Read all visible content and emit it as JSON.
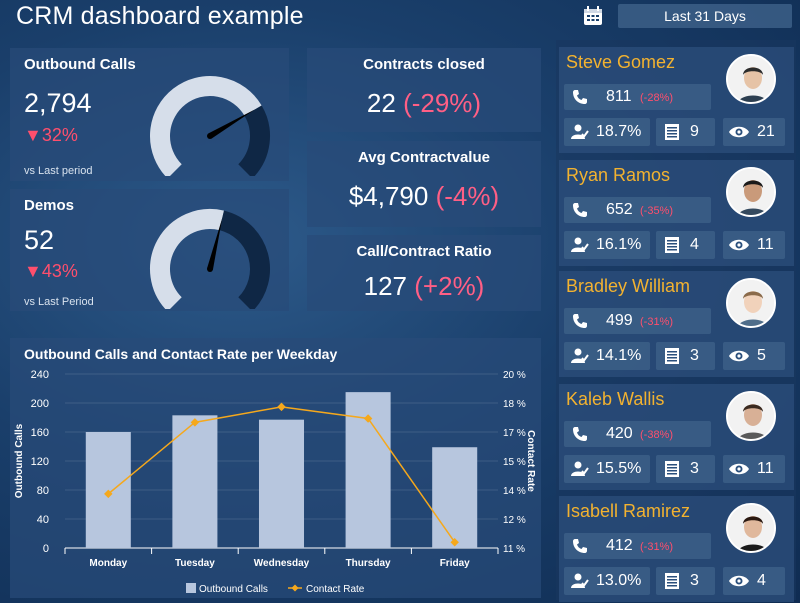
{
  "header": {
    "title": "CRM dashboard example",
    "date_range": "Last 31 Days"
  },
  "kpis": {
    "outbound_calls": {
      "title": "Outbound Calls",
      "value": "2,794",
      "change": "32%",
      "sub": "vs Last period",
      "gauge_fraction": 0.72
    },
    "demos": {
      "title": "Demos",
      "value": "52",
      "change": "43%",
      "sub": "vs Last Period",
      "gauge_fraction": 0.55
    },
    "contracts_closed": {
      "title": "Contracts closed",
      "value": "22",
      "change": "(-29%)"
    },
    "avg_contract_value": {
      "title": "Avg Contractvalue",
      "value": "$4,790",
      "change": "(-4%)"
    },
    "call_contract_ratio": {
      "title": "Call/Contract Ratio",
      "value": "127",
      "change": "(+2%)"
    }
  },
  "people": [
    {
      "name": "Steve Gomez",
      "calls": "811",
      "calls_change": "(-28%)",
      "rate": "18.7%",
      "count": "9",
      "views": "21"
    },
    {
      "name": "Ryan Ramos",
      "calls": "652",
      "calls_change": "(-35%)",
      "rate": "16.1%",
      "count": "4",
      "views": "11"
    },
    {
      "name": "Bradley William",
      "calls": "499",
      "calls_change": "(-31%)",
      "rate": "14.1%",
      "count": "3",
      "views": "5"
    },
    {
      "name": "Kaleb Wallis",
      "calls": "420",
      "calls_change": "(-38%)",
      "rate": "15.5%",
      "count": "3",
      "views": "11"
    },
    {
      "name": "Isabell Ramirez",
      "calls": "412",
      "calls_change": "(-31%)",
      "rate": "13.0%",
      "count": "3",
      "views": "4"
    }
  ],
  "chart_data": {
    "type": "bar",
    "title": "Outbound Calls and Contact Rate per Weekday",
    "categories": [
      "Monday",
      "Tuesday",
      "Wednesday",
      "Thursday",
      "Friday"
    ],
    "series": [
      {
        "name": "Outbound Calls",
        "type": "bar",
        "axis": "left",
        "values": [
          160,
          183,
          177,
          215,
          139
        ]
      },
      {
        "name": "Contact Rate",
        "type": "line",
        "axis": "right",
        "values": [
          13.8,
          17.5,
          18.3,
          17.7,
          11.3
        ]
      }
    ],
    "ylabel": "Outbound Calls",
    "y2label": "Contact Rate",
    "ylim": [
      0,
      240
    ],
    "yticks": [
      "0",
      "40",
      "80",
      "120",
      "160",
      "200",
      "240"
    ],
    "y2lim": [
      11,
      20
    ],
    "y2ticks": [
      "11 %",
      "12 %",
      "14 %",
      "15 %",
      "17 %",
      "18 %",
      "20 %"
    ],
    "legend_position": "bottom",
    "colors": {
      "bar": "#b7c6de",
      "line": "#f5a81c"
    }
  }
}
